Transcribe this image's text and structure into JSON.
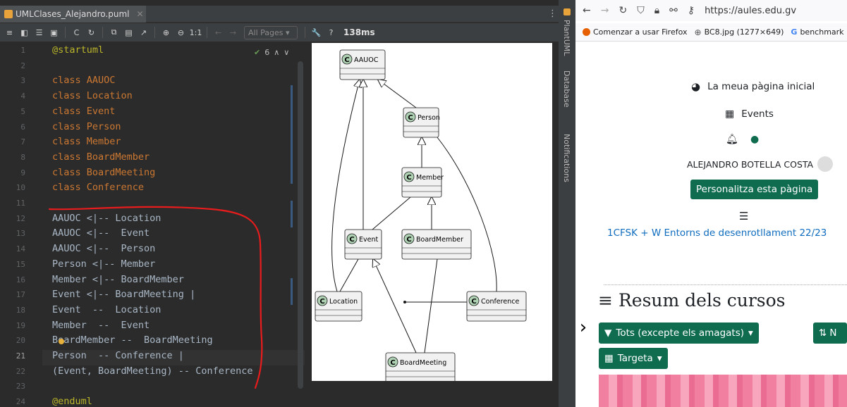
{
  "ide": {
    "tab_name": "UMLClases_Alejandro.puml",
    "toolbar": {
      "zoom_label": "1:1",
      "pages_select": "All Pages",
      "help_label": "?",
      "timing": "138ms"
    },
    "inspection_count": "6",
    "code_lines": [
      {
        "n": "1",
        "text": "@startuml",
        "kind": "dir"
      },
      {
        "n": "2",
        "text": "",
        "kind": "plain"
      },
      {
        "n": "3",
        "text": "class AAUOC",
        "kind": "kw"
      },
      {
        "n": "4",
        "text": "class Location",
        "kind": "kw"
      },
      {
        "n": "5",
        "text": "class Event",
        "kind": "kw"
      },
      {
        "n": "6",
        "text": "class Person",
        "kind": "kw"
      },
      {
        "n": "7",
        "text": "class Member",
        "kind": "kw"
      },
      {
        "n": "8",
        "text": "class BoardMember",
        "kind": "kw"
      },
      {
        "n": "9",
        "text": "class BoardMeeting",
        "kind": "kw"
      },
      {
        "n": "10",
        "text": "class Conference",
        "kind": "kw"
      },
      {
        "n": "11",
        "text": "",
        "kind": "plain"
      },
      {
        "n": "12",
        "text": "AAUOC <|-- Location",
        "kind": "plain"
      },
      {
        "n": "13",
        "text": "AAUOC <|--  Event",
        "kind": "plain"
      },
      {
        "n": "14",
        "text": "AAUOC <|--  Person",
        "kind": "plain"
      },
      {
        "n": "15",
        "text": "Person <|-- Member",
        "kind": "plain"
      },
      {
        "n": "16",
        "text": "Member <|-- BoardMember",
        "kind": "plain"
      },
      {
        "n": "17",
        "text": "Event <|-- BoardMeeting |",
        "kind": "plain"
      },
      {
        "n": "18",
        "text": "Event  --  Location",
        "kind": "plain"
      },
      {
        "n": "19",
        "text": "Member  --  Event",
        "kind": "plain"
      },
      {
        "n": "20",
        "text": "BoardMember --  BoardMeeting",
        "kind": "plain"
      },
      {
        "n": "21",
        "text": "Person  -- Conference |",
        "kind": "plain"
      },
      {
        "n": "22",
        "text": "(Event, BoardMeeting) -- Conference",
        "kind": "plain"
      },
      {
        "n": "23",
        "text": "",
        "kind": "plain"
      },
      {
        "n": "24",
        "text": "@enduml",
        "kind": "dir"
      }
    ],
    "side_labels": [
      "PlantUML",
      "Database",
      "Notifications"
    ]
  },
  "diagram": {
    "class_badge": "C",
    "classes": [
      "AAUOC",
      "Person",
      "Member",
      "Event",
      "BoardMember",
      "Location",
      "Conference",
      "BoardMeeting"
    ]
  },
  "browser": {
    "url": "https://aules.edu.gv",
    "bookmarks": [
      "Comenzar a usar Firefox",
      "BC8.jpg (1277×649)",
      "benchmark"
    ],
    "bookmark_colors": {
      "firefox": "#e66000",
      "globe": "#555555",
      "google": "#4285f4"
    },
    "moodle": {
      "home_link": "La meua pàgina inicial",
      "events_link": "Events",
      "user_name": "ALEJANDRO BOTELLA COSTA",
      "customize_button": "Personalitza esta pàgina",
      "course_link": "1CFSK + W Entorns de desenrotllament 22/23",
      "section_title": "Resum dels cursos",
      "filter_button": "Tots (excepte els amagats)",
      "sort_button": "N",
      "view_button": "Targeta",
      "accent_color": "#0f6c4f"
    }
  }
}
